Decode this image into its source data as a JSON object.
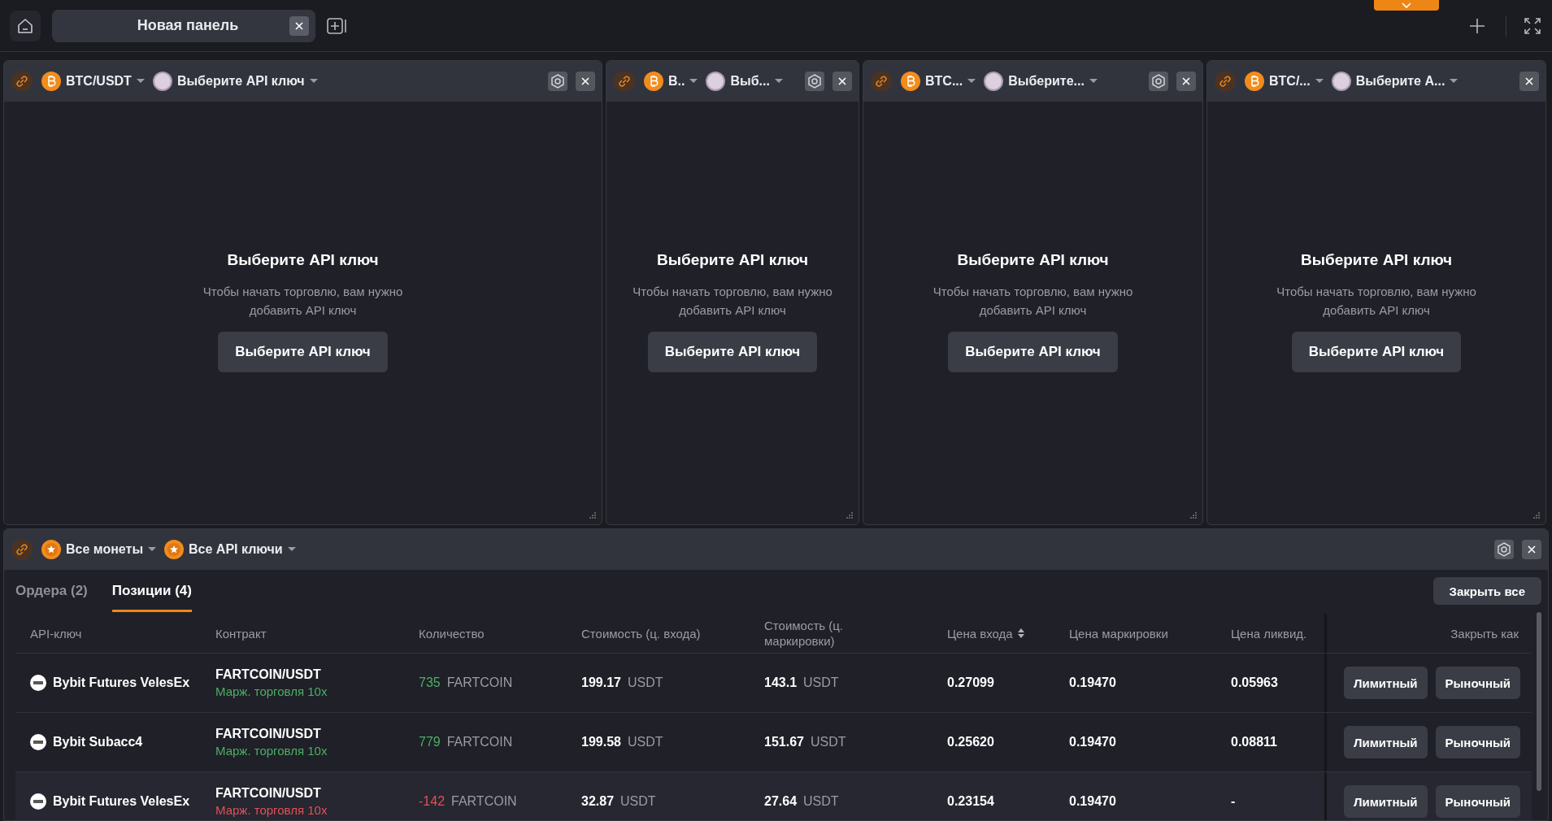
{
  "top_bar": {
    "tabs": [
      {
        "label": "Новая панель",
        "selected": true
      }
    ]
  },
  "panels": [
    {
      "pair": "BTC/USDT",
      "api_key": "Выберите API ключ",
      "settings": true,
      "empty_title": "Выберите API ключ",
      "empty_text": "Чтобы начать торговлю, вам нужно добавить API ключ",
      "button": "Выберите API ключ"
    },
    {
      "pair": "B..",
      "api_key": "Выб...",
      "settings": true,
      "empty_title": "Выберите API ключ",
      "empty_text": "Чтобы начать торговлю, вам нужно добавить API ключ",
      "button": "Выберите API ключ"
    },
    {
      "pair": "BTC...",
      "api_key": "Выберите...",
      "settings": true,
      "empty_title": "Выберите API ключ",
      "empty_text": "Чтобы начать торговлю, вам нужно добавить API ключ",
      "button": "Выберите API ключ"
    },
    {
      "pair": "BTC/...",
      "api_key": "Выберите A...",
      "settings": false,
      "empty_title": "Выберите API ключ",
      "empty_text": "Чтобы начать торговлю, вам нужно добавить API ключ",
      "button": "Выберите API ключ"
    }
  ],
  "positions_panel": {
    "coins_filter": "Все монеты",
    "api_filter": "Все API ключи",
    "tabs": [
      {
        "label": "Ордера (2)",
        "selected": false
      },
      {
        "label": "Позиции (4)",
        "selected": true
      }
    ],
    "close_all": "Закрыть все",
    "columns": [
      {
        "label": "API-ключ",
        "sortable": false
      },
      {
        "label": "Контракт",
        "sortable": false
      },
      {
        "label": "Количество",
        "sortable": false
      },
      {
        "label": "Стоимость (ц. входа)",
        "sortable": false
      },
      {
        "label": "Стоимость (ц. маркировки)",
        "sortable": false
      },
      {
        "label": "Цена входа",
        "sortable": true
      },
      {
        "label": "Цена маркировки",
        "sortable": false
      },
      {
        "label": "Цена ликвид.",
        "sortable": false
      },
      {
        "label": "Закрыть как",
        "sortable": false
      }
    ],
    "rows": [
      {
        "api_key": "Bybit Futures VelesEx",
        "contract": "FARTCOIN/USDT",
        "mode": "Марж. торговля 10x",
        "color": "#4caf64",
        "qty": "735",
        "qty_unit": "FARTCOIN",
        "cost_entry": "199.17",
        "cost_entry_unit": "USDT",
        "cost_mark": "143.1",
        "cost_mark_unit": "USDT",
        "entry_price": "0.27099",
        "mark_price": "0.19470",
        "liq_price": "0.05963",
        "buttons": [
          "Лимитный",
          "Рыночный"
        ]
      },
      {
        "api_key": "Bybit Subacc4",
        "contract": "FARTCOIN/USDT",
        "mode": "Марж. торговля 10x",
        "color": "#4caf64",
        "qty": "779",
        "qty_unit": "FARTCOIN",
        "cost_entry": "199.58",
        "cost_entry_unit": "USDT",
        "cost_mark": "151.67",
        "cost_mark_unit": "USDT",
        "entry_price": "0.25620",
        "mark_price": "0.19470",
        "liq_price": "0.08811",
        "buttons": [
          "Лимитный",
          "Рыночный"
        ]
      },
      {
        "api_key": "Bybit Futures VelesEx",
        "contract": "FARTCOIN/USDT",
        "mode": "Марж. торговля 10x",
        "color": "#e0505a",
        "qty": "-142",
        "qty_unit": "FARTCOIN",
        "cost_entry": "32.87",
        "cost_entry_unit": "USDT",
        "cost_mark": "27.64",
        "cost_mark_unit": "USDT",
        "entry_price": "0.23154",
        "mark_price": "0.19470",
        "liq_price": "-",
        "buttons": [
          "Лимитный",
          "Рыночный"
        ]
      }
    ]
  }
}
